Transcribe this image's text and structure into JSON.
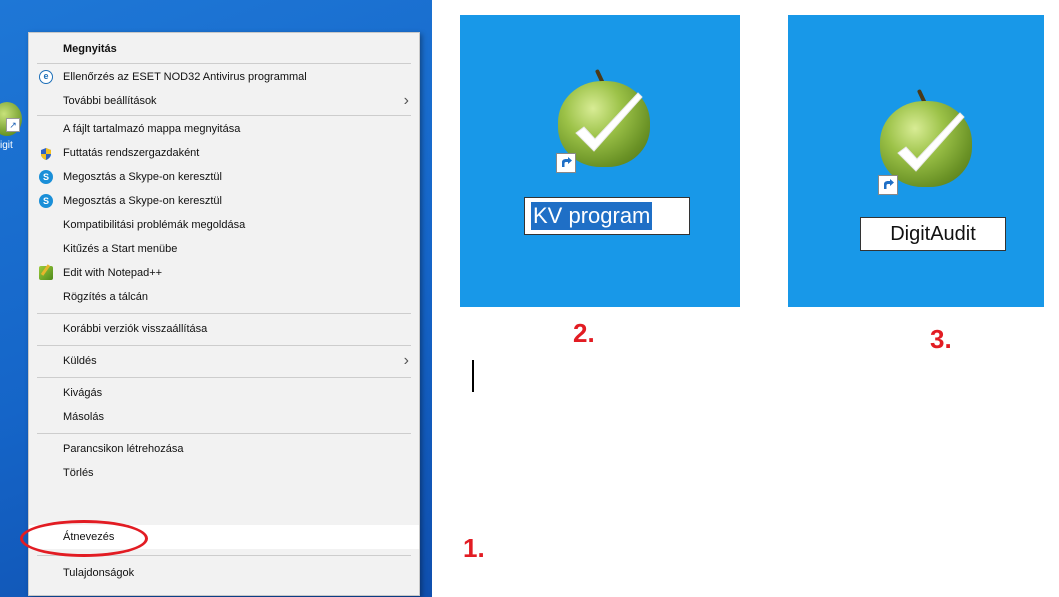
{
  "context_menu": {
    "items": [
      {
        "label": "Megnyitás",
        "bold": true
      },
      {
        "label": "Ellenőrzés az ESET NOD32 Antivirus programmal",
        "icon": "eset-icon"
      },
      {
        "label": "További beállítások",
        "submenu": true
      },
      {
        "label": "A fájlt tartalmazó mappa megnyitása"
      },
      {
        "label": "Futtatás rendszergazdaként",
        "icon": "uac-shield-icon"
      },
      {
        "label": "Megosztás a Skype-on keresztül",
        "icon": "skype-icon"
      },
      {
        "label": "Megosztás a Skype-on keresztül",
        "icon": "skype-icon"
      },
      {
        "label": "Kompatibilitási problémák megoldása"
      },
      {
        "label": "Kitűzés a Start menübe"
      },
      {
        "label": "Edit with Notepad++",
        "icon": "notepad-plus-plus-icon"
      },
      {
        "label": "Rögzítés a tálcán"
      },
      {
        "label": "Korábbi verziók visszaállítása"
      },
      {
        "label": "Küldés",
        "submenu": true
      },
      {
        "label": "Kivágás"
      },
      {
        "label": "Másolás"
      },
      {
        "label": "Parancsikon létrehozása"
      },
      {
        "label": "Törlés"
      },
      {
        "label": "Átnevezés",
        "highlighted": true
      },
      {
        "label": "Tulajdonságok"
      }
    ],
    "submenu_glyph": "›"
  },
  "desktop_icon_peek": {
    "label": "igit"
  },
  "panel2": {
    "icon_label": "KV program",
    "step": "2."
  },
  "panel3": {
    "icon_label": "DigitAudit",
    "step": "3."
  },
  "panel1": {
    "step": "1."
  },
  "colors": {
    "desktop_blue": "#1898e8",
    "selection_blue": "#1f6fc6",
    "annotation_red": "#e21c23",
    "menu_bg": "#f2f2f2"
  }
}
